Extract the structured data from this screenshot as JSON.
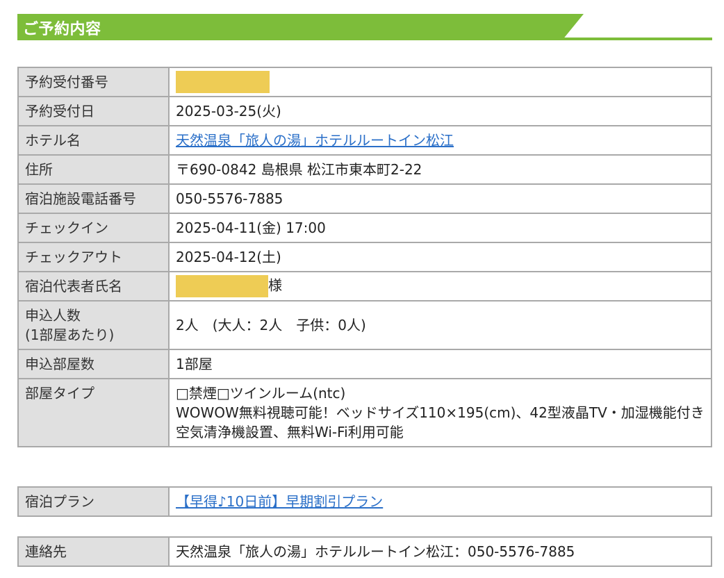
{
  "section": {
    "title": "ご予約内容"
  },
  "reservation_rows": [
    {
      "label": "予約受付番号",
      "value": ""
    },
    {
      "label": "予約受付日",
      "value": "2025-03-25(火)"
    },
    {
      "label": "ホテル名",
      "value": "天然温泉「旅人の湯」ホテルルートイン松江"
    },
    {
      "label": "住所",
      "value": "〒690-0842 島根県 松江市東本町2-22"
    },
    {
      "label": "宿泊施設電話番号",
      "value": "050-5576-7885"
    },
    {
      "label": "チェックイン",
      "value": "2025-04-11(金) 17:00"
    },
    {
      "label": "チェックアウト",
      "value": "2025-04-12(土)"
    },
    {
      "label": "宿泊代表者氏名",
      "value": "様"
    },
    {
      "label_line1": "申込人数",
      "label_line2": "(1部屋あたり)",
      "value": "2人　(大人：2人　子供：0人)"
    },
    {
      "label": "申込部屋数",
      "value": "1部屋"
    },
    {
      "label": "部屋タイプ",
      "value_line1": "□禁煙□ツインルーム(ntc)",
      "value_line2": "WOWOW無料視聴可能！ベッドサイズ110×195(cm)、42型液晶TV・加湿機能付き空気清浄機設置、無料Wi-Fi利用可能"
    }
  ],
  "plan": {
    "label": "宿泊プラン",
    "value": "【早得♪10日前】早期割引プラン"
  },
  "contact": {
    "label": "連絡先",
    "value": "天然温泉「旅人の湯」ホテルルートイン松江：050-5576-7885"
  },
  "colors": {
    "accent_green": "#7dbd3a",
    "redaction_yellow": "#eecc55",
    "link_blue": "#2a6fc8",
    "label_bg": "#e0e0e0",
    "border_gray": "#a9a9a9"
  }
}
